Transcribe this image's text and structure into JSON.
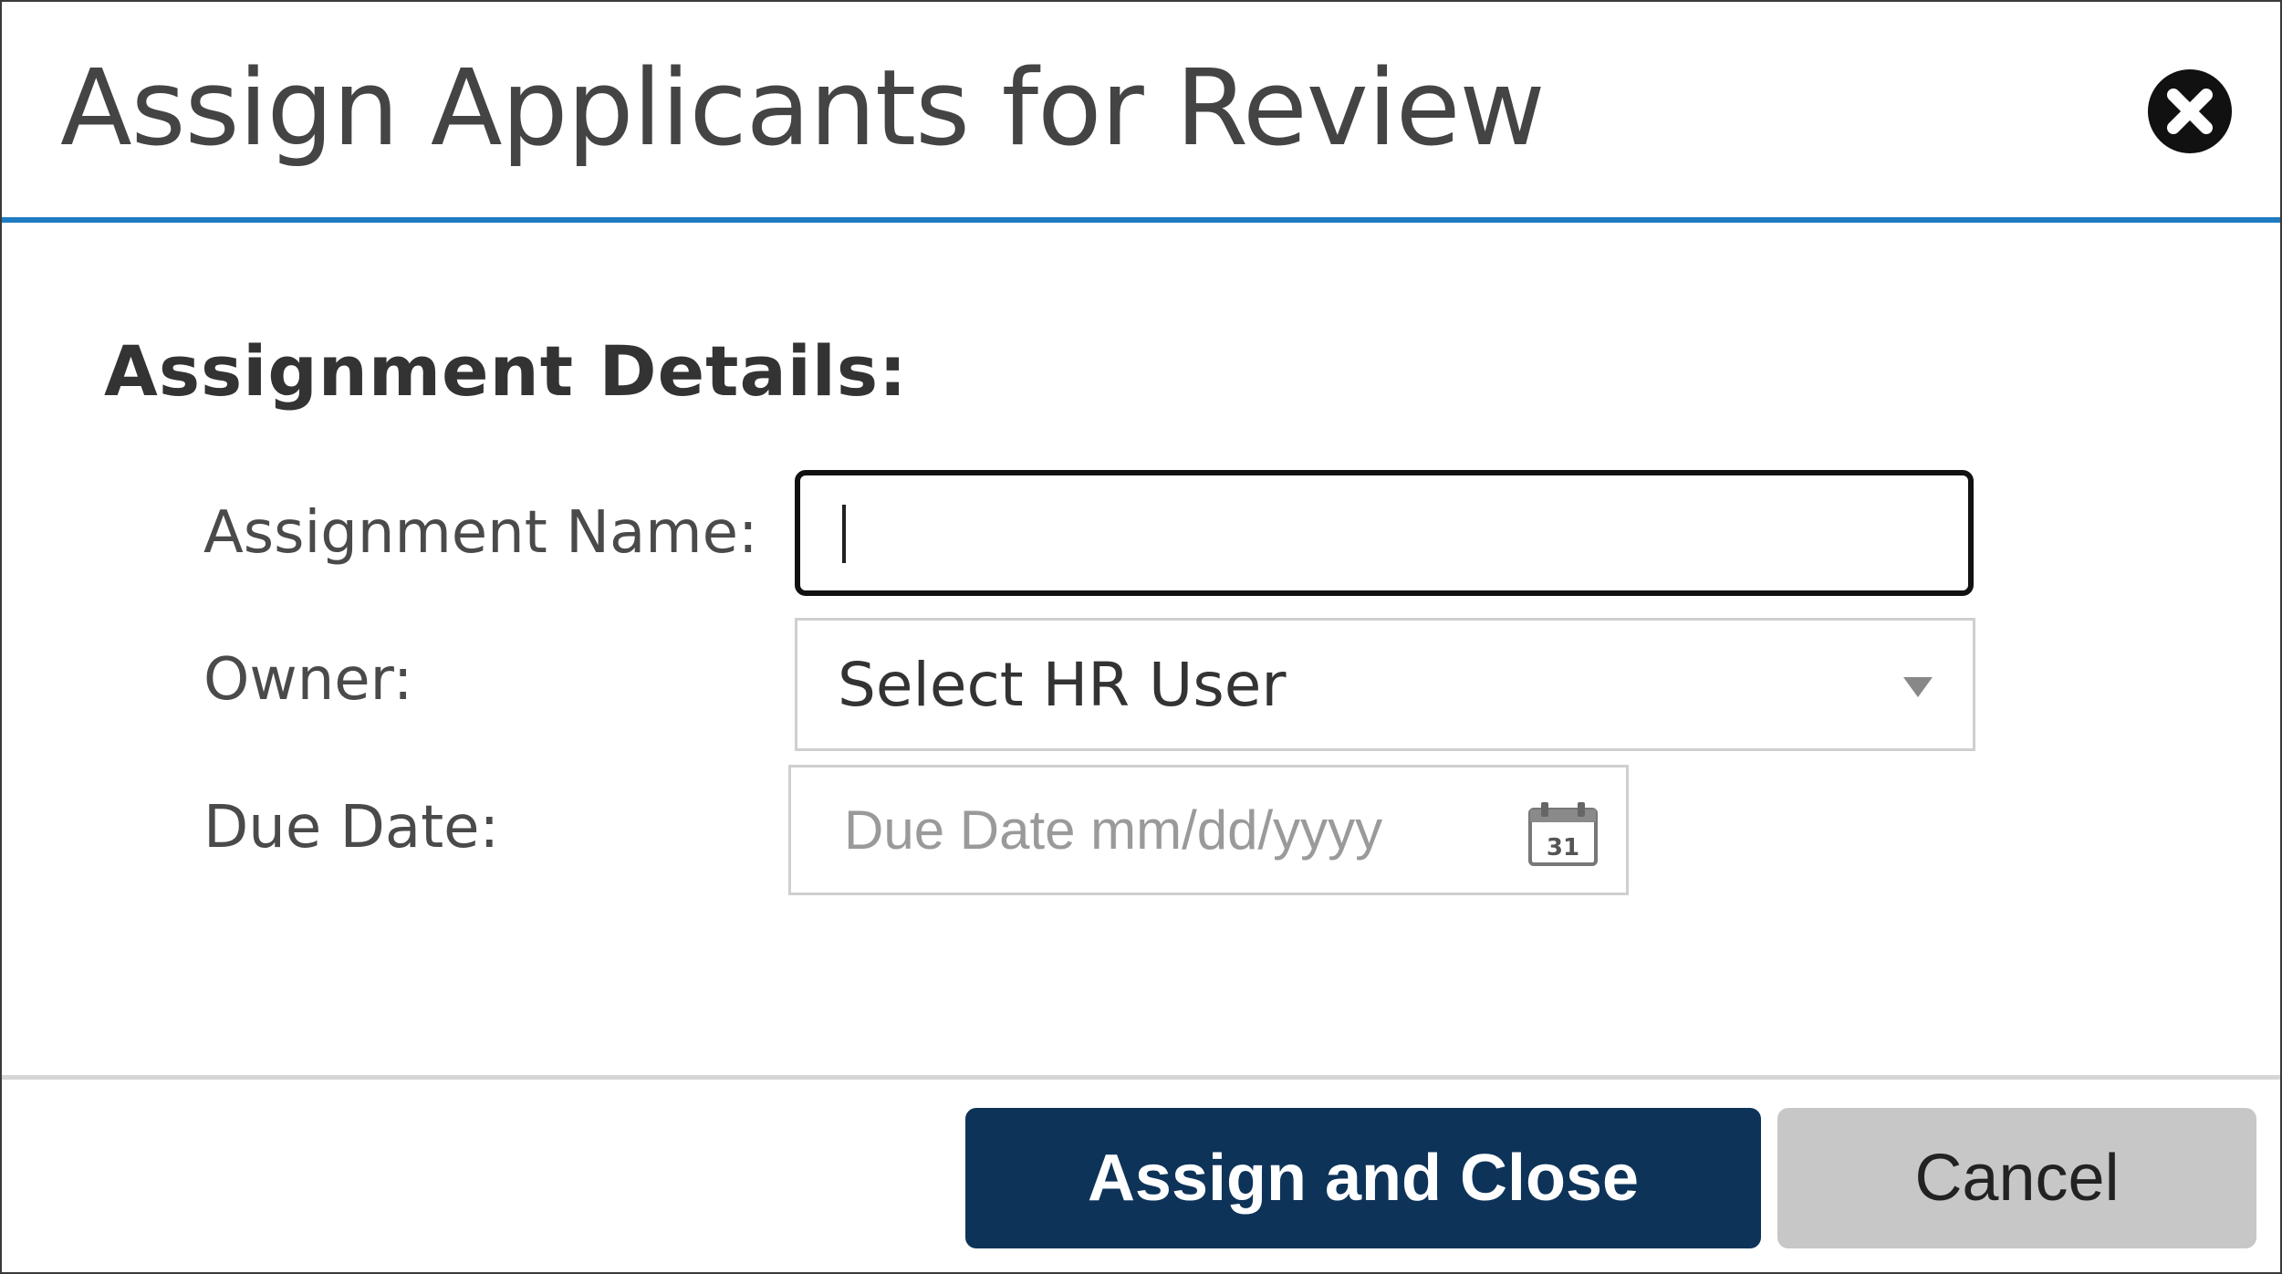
{
  "dialog": {
    "title": "Assign Applicants for Review",
    "close_icon": "close-circle-icon"
  },
  "form": {
    "section_title": "Assignment Details:",
    "assignment_name": {
      "label": "Assignment Name:",
      "value": ""
    },
    "owner": {
      "label": "Owner:",
      "selected": "Select HR User"
    },
    "due_date": {
      "label": "Due Date:",
      "placeholder": "Due Date mm/dd/yyyy",
      "value": "",
      "calendar_icon": "calendar-icon",
      "calendar_day": "31"
    }
  },
  "footer": {
    "assign_label": "Assign and Close",
    "cancel_label": "Cancel"
  },
  "colors": {
    "header_underline": "#1f7bc1",
    "primary_button": "#0d3359",
    "secondary_button": "#c7c7c7"
  }
}
